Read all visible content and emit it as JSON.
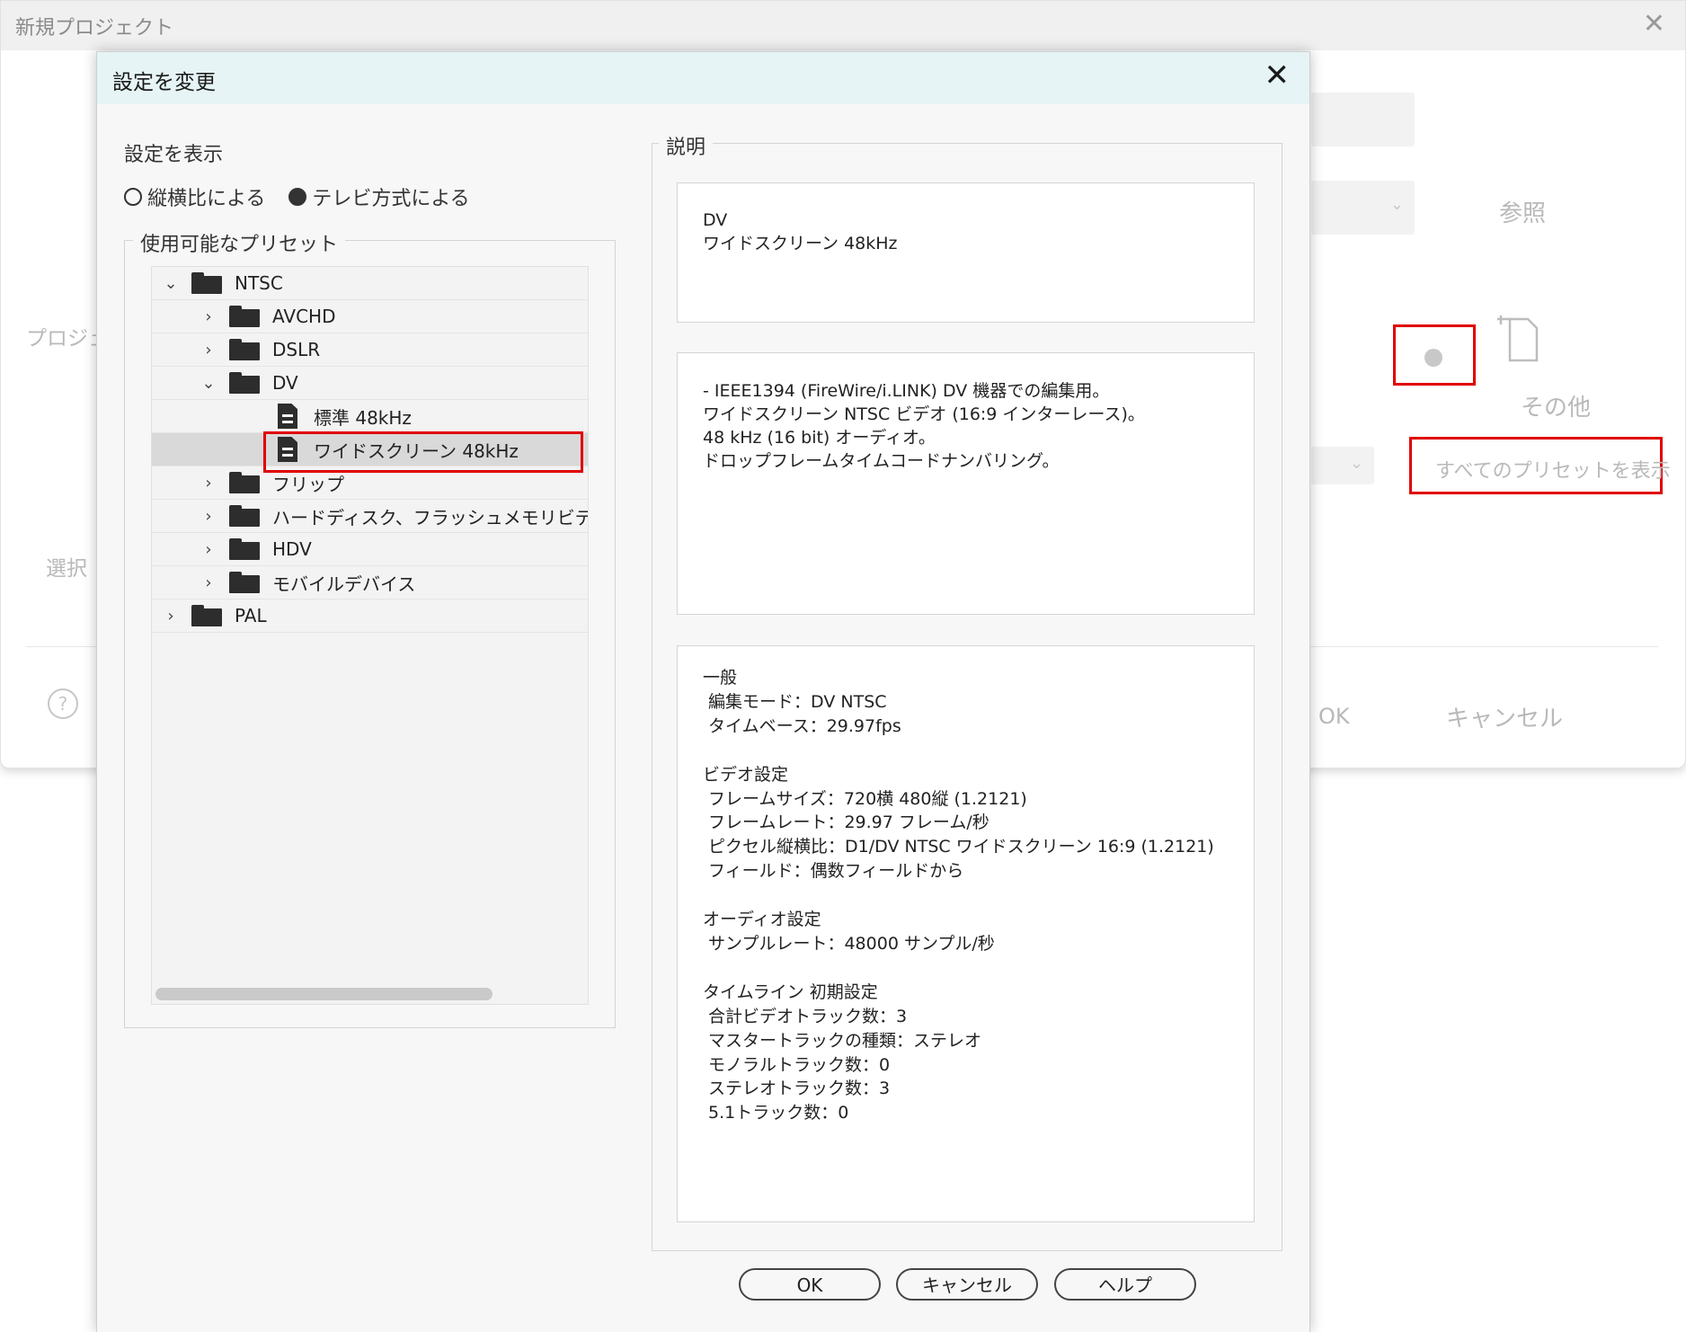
{
  "background_window": {
    "title": "新規プロジェクト",
    "close_glyph": "✕",
    "browse_label": "参照",
    "other_label": "その他",
    "show_all_presets_label": "すべてのプリセットを表示",
    "ok_label": "OK",
    "cancel_label": "キャンセル",
    "left_labels": [
      "プロジェ",
      "選択"
    ],
    "help_glyph": "?"
  },
  "dialog": {
    "title": "設定を変更",
    "close_glyph": "✕",
    "display_settings_label": "設定を表示",
    "radio_options": [
      {
        "label": "縦横比による",
        "selected": false
      },
      {
        "label": "テレビ方式による",
        "selected": true
      }
    ],
    "presets_group_label": "使用可能なプリセット",
    "tree": [
      {
        "label": "NTSC",
        "level": 0,
        "expanded": true,
        "type": "folder"
      },
      {
        "label": "AVCHD",
        "level": 1,
        "expanded": false,
        "type": "folder"
      },
      {
        "label": "DSLR",
        "level": 1,
        "expanded": false,
        "type": "folder"
      },
      {
        "label": "DV",
        "level": 1,
        "expanded": true,
        "type": "folder"
      },
      {
        "label": "標準 48kHz",
        "level": 2,
        "type": "preset"
      },
      {
        "label": "ワイドスクリーン 48kHz",
        "level": 2,
        "type": "preset",
        "selected": true
      },
      {
        "label": "フリップ",
        "level": 1,
        "expanded": false,
        "type": "folder"
      },
      {
        "label": "ハードディスク、フラッシュメモリビデオカ",
        "level": 1,
        "expanded": false,
        "type": "folder"
      },
      {
        "label": "HDV",
        "level": 1,
        "expanded": false,
        "type": "folder"
      },
      {
        "label": "モバイルデバイス",
        "level": 1,
        "expanded": false,
        "type": "folder"
      },
      {
        "label": "PAL",
        "level": 0,
        "expanded": false,
        "type": "folder"
      }
    ],
    "description_label": "説明",
    "desc_name": "DV\nワイドスクリーン 48kHz",
    "desc_summary": "- IEEE1394 (FireWire/i.LINK) DV 機器での編集用。\nワイドスクリーン NTSC ビデオ (16:9 インターレース)。\n48 kHz (16 bit) オーディオ。\nドロップフレームタイムコードナンバリング。",
    "desc_details": "一般\n 編集モード：DV NTSC\n タイムベース：29.97fps\n\nビデオ設定\n フレームサイズ：720横 480縦 (1.2121)\n フレームレート：29.97 フレーム/秒\n ピクセル縦横比：D1/DV NTSC ワイドスクリーン 16:9 (1.2121)\n フィールド：偶数フィールドから\n\nオーディオ設定\n サンプルレート：48000 サンプル/秒\n\nタイムライン 初期設定\n 合計ビデオトラック数：3\n マスタートラックの種類：ステレオ\n モノラルトラック数：0\n ステレオトラック数：3\n 5.1トラック数：0",
    "buttons": {
      "ok": "OK",
      "cancel": "キャンセル",
      "help": "ヘルプ"
    }
  },
  "highlight_color": "#e00000"
}
